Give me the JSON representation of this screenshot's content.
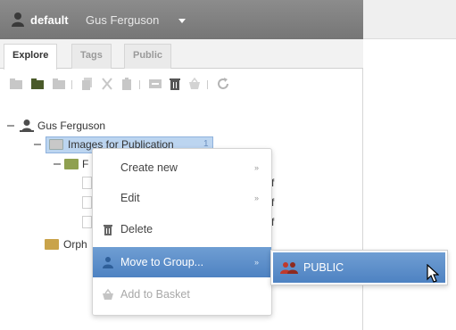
{
  "header": {
    "group_name": "default",
    "user_name": "Gus Ferguson"
  },
  "tabs": [
    {
      "label": "Explore",
      "active": true
    },
    {
      "label": "Tags",
      "active": false
    },
    {
      "label": "Public",
      "active": false
    }
  ],
  "toolbar": {
    "icons": [
      "new-container-icon",
      "folder-icon",
      "project-icon",
      "copy-icon",
      "cut-icon",
      "paste-icon",
      "remove-icon",
      "delete-icon",
      "basket-icon",
      "refresh-icon"
    ]
  },
  "tree": {
    "root_label": "Gus Ferguson",
    "selected_label": "Images for Publication",
    "selected_count": "1",
    "child_folder_label": "F",
    "orphaned_label": "Orph",
    "doc_suffixes": [
      "f",
      "f",
      "f"
    ]
  },
  "context_menu": {
    "items": [
      {
        "label": "Create new",
        "arrow": "»"
      },
      {
        "label": "Edit",
        "arrow": "»"
      },
      {
        "label": "Delete"
      },
      {
        "label": "Move to Group...",
        "arrow": "»"
      },
      {
        "label": "Add to Basket"
      }
    ]
  },
  "submenu": {
    "item_label": "PUBLIC"
  },
  "colors": {
    "header_bg": "#7f7f7f",
    "highlight": "#5b8cc9",
    "folder": "#c9a34a",
    "selected_node": "#bcd5f0"
  }
}
